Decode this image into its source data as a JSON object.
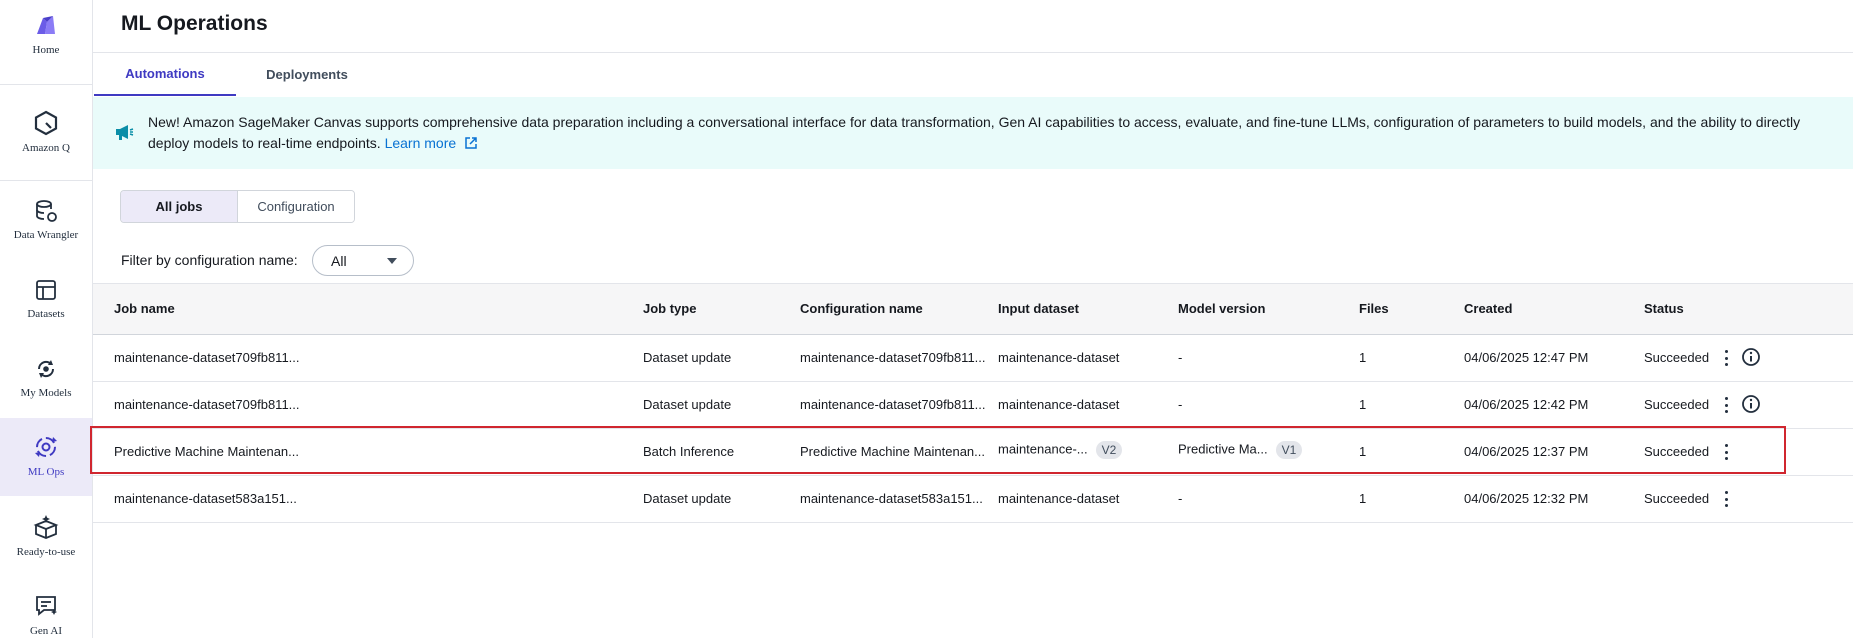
{
  "sidebar": {
    "items": [
      {
        "label": "Home",
        "icon": "canvas-logo-icon"
      },
      {
        "label": "Amazon Q",
        "icon": "amazon-q-icon"
      },
      {
        "label": "Data Wrangler",
        "icon": "data-wrangler-icon"
      },
      {
        "label": "Datasets",
        "icon": "datasets-icon"
      },
      {
        "label": "My Models",
        "icon": "my-models-icon"
      },
      {
        "label": "ML Ops",
        "icon": "ml-ops-icon"
      },
      {
        "label": "Ready-to-use",
        "icon": "ready-to-use-icon"
      },
      {
        "label": "Gen AI",
        "icon": "gen-ai-icon"
      }
    ]
  },
  "header": {
    "title": "ML Operations"
  },
  "tabs": [
    {
      "label": "Automations",
      "active": true
    },
    {
      "label": "Deployments",
      "active": false
    }
  ],
  "banner": {
    "text": "New! Amazon SageMaker Canvas supports comprehensive data preparation including a conversational interface for data transformation, Gen AI capabilities to access, evaluate, and fine-tune LLMs, configuration of parameters to build models, and the ability to directly deploy models to real-time endpoints.",
    "link": "Learn more",
    "icon": "megaphone-icon"
  },
  "segmented": {
    "all_jobs": "All jobs",
    "configuration": "Configuration"
  },
  "filter": {
    "label": "Filter by configuration name:",
    "value": "All"
  },
  "table": {
    "columns": [
      "Job name",
      "Job type",
      "Configuration name",
      "Input dataset",
      "Model version",
      "Files",
      "Created",
      "Status"
    ],
    "rows": [
      {
        "job_name": "maintenance-dataset709fb811...",
        "job_type": "Dataset update",
        "config": "maintenance-dataset709fb811...",
        "input": "maintenance-dataset",
        "input_badge": "",
        "model": "-",
        "model_badge": "",
        "files": "1",
        "created": "04/06/2025 12:47 PM",
        "status": "Succeeded"
      },
      {
        "job_name": "maintenance-dataset709fb811...",
        "job_type": "Dataset update",
        "config": "maintenance-dataset709fb811...",
        "input": "maintenance-dataset",
        "input_badge": "",
        "model": "-",
        "model_badge": "",
        "files": "1",
        "created": "04/06/2025 12:42 PM",
        "status": "Succeeded"
      },
      {
        "job_name": "Predictive Machine Maintenan...",
        "job_type": "Batch Inference",
        "config": "Predictive Machine Maintenan...",
        "input": "maintenance-...",
        "input_badge": "V2",
        "model": "Predictive Ma...",
        "model_badge": "V1",
        "files": "1",
        "created": "04/06/2025 12:37 PM",
        "status": "Succeeded"
      },
      {
        "job_name": "maintenance-dataset583a151...",
        "job_type": "Dataset update",
        "config": "maintenance-dataset583a151...",
        "input": "maintenance-dataset",
        "input_badge": "",
        "model": "-",
        "model_badge": "",
        "files": "1",
        "created": "04/06/2025 12:32 PM",
        "status": "Succeeded"
      }
    ]
  },
  "colors": {
    "accent": "#3f3ac2",
    "link": "#0972d3",
    "banner_bg": "#e9fbfa",
    "highlight": "#d0262f"
  }
}
